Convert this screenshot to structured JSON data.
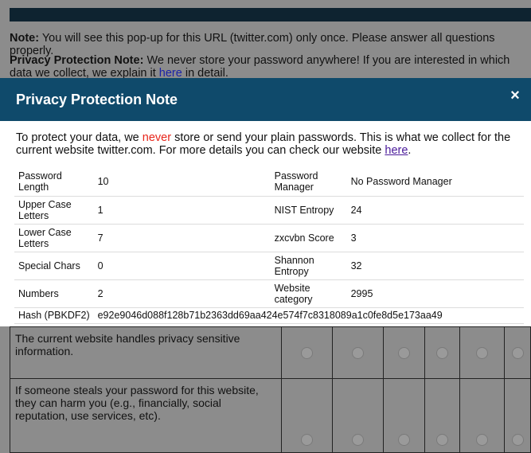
{
  "page": {
    "note_label": "Note:",
    "note_text": " You will see this pop-up for this URL (twitter.com) only once. Please answer all questions properly.",
    "privacy_label": "Privacy Protection Note:",
    "privacy_text_1": " We never store your password anywhere! If you are interested in which data we collect, we explain it ",
    "privacy_link": "here",
    "privacy_text_2": " in detail."
  },
  "modal": {
    "title": "Privacy Protection Note",
    "close": "×",
    "intro_1": "To protect your data, we ",
    "intro_never": "never",
    "intro_2": " store or send your plain passwords. This is what we collect for the current website twitter.com. For more details you can check our website ",
    "intro_link": "here",
    "intro_3": ".",
    "rows": [
      {
        "k1": "Password Length",
        "v1": "10",
        "k2": "Password Manager",
        "v2": "No Password Manager"
      },
      {
        "k1": "Upper Case Letters",
        "v1": "1",
        "k2": "NIST Entropy",
        "v2": "24"
      },
      {
        "k1": "Lower Case Letters",
        "v1": "7",
        "k2": "zxcvbn Score",
        "v2": "3"
      },
      {
        "k1": "Special Chars",
        "v1": "0",
        "k2": "Shannon Entropy",
        "v2": "32"
      },
      {
        "k1": "Numbers",
        "v1": "2",
        "k2": "Website category",
        "v2": "2995"
      }
    ],
    "hash_label": "Hash (PBKDF2)",
    "hash_value": "e92e9046d088f128b71b2363dd69aa424e574f7c8318089a1c0fe8d5e173aa49"
  },
  "survey": {
    "questions": [
      "The current website handles privacy sensitive information.",
      "If someone steals your password for this website, they can harm you (e.g., financially, social reputation, use services, etc)."
    ]
  }
}
